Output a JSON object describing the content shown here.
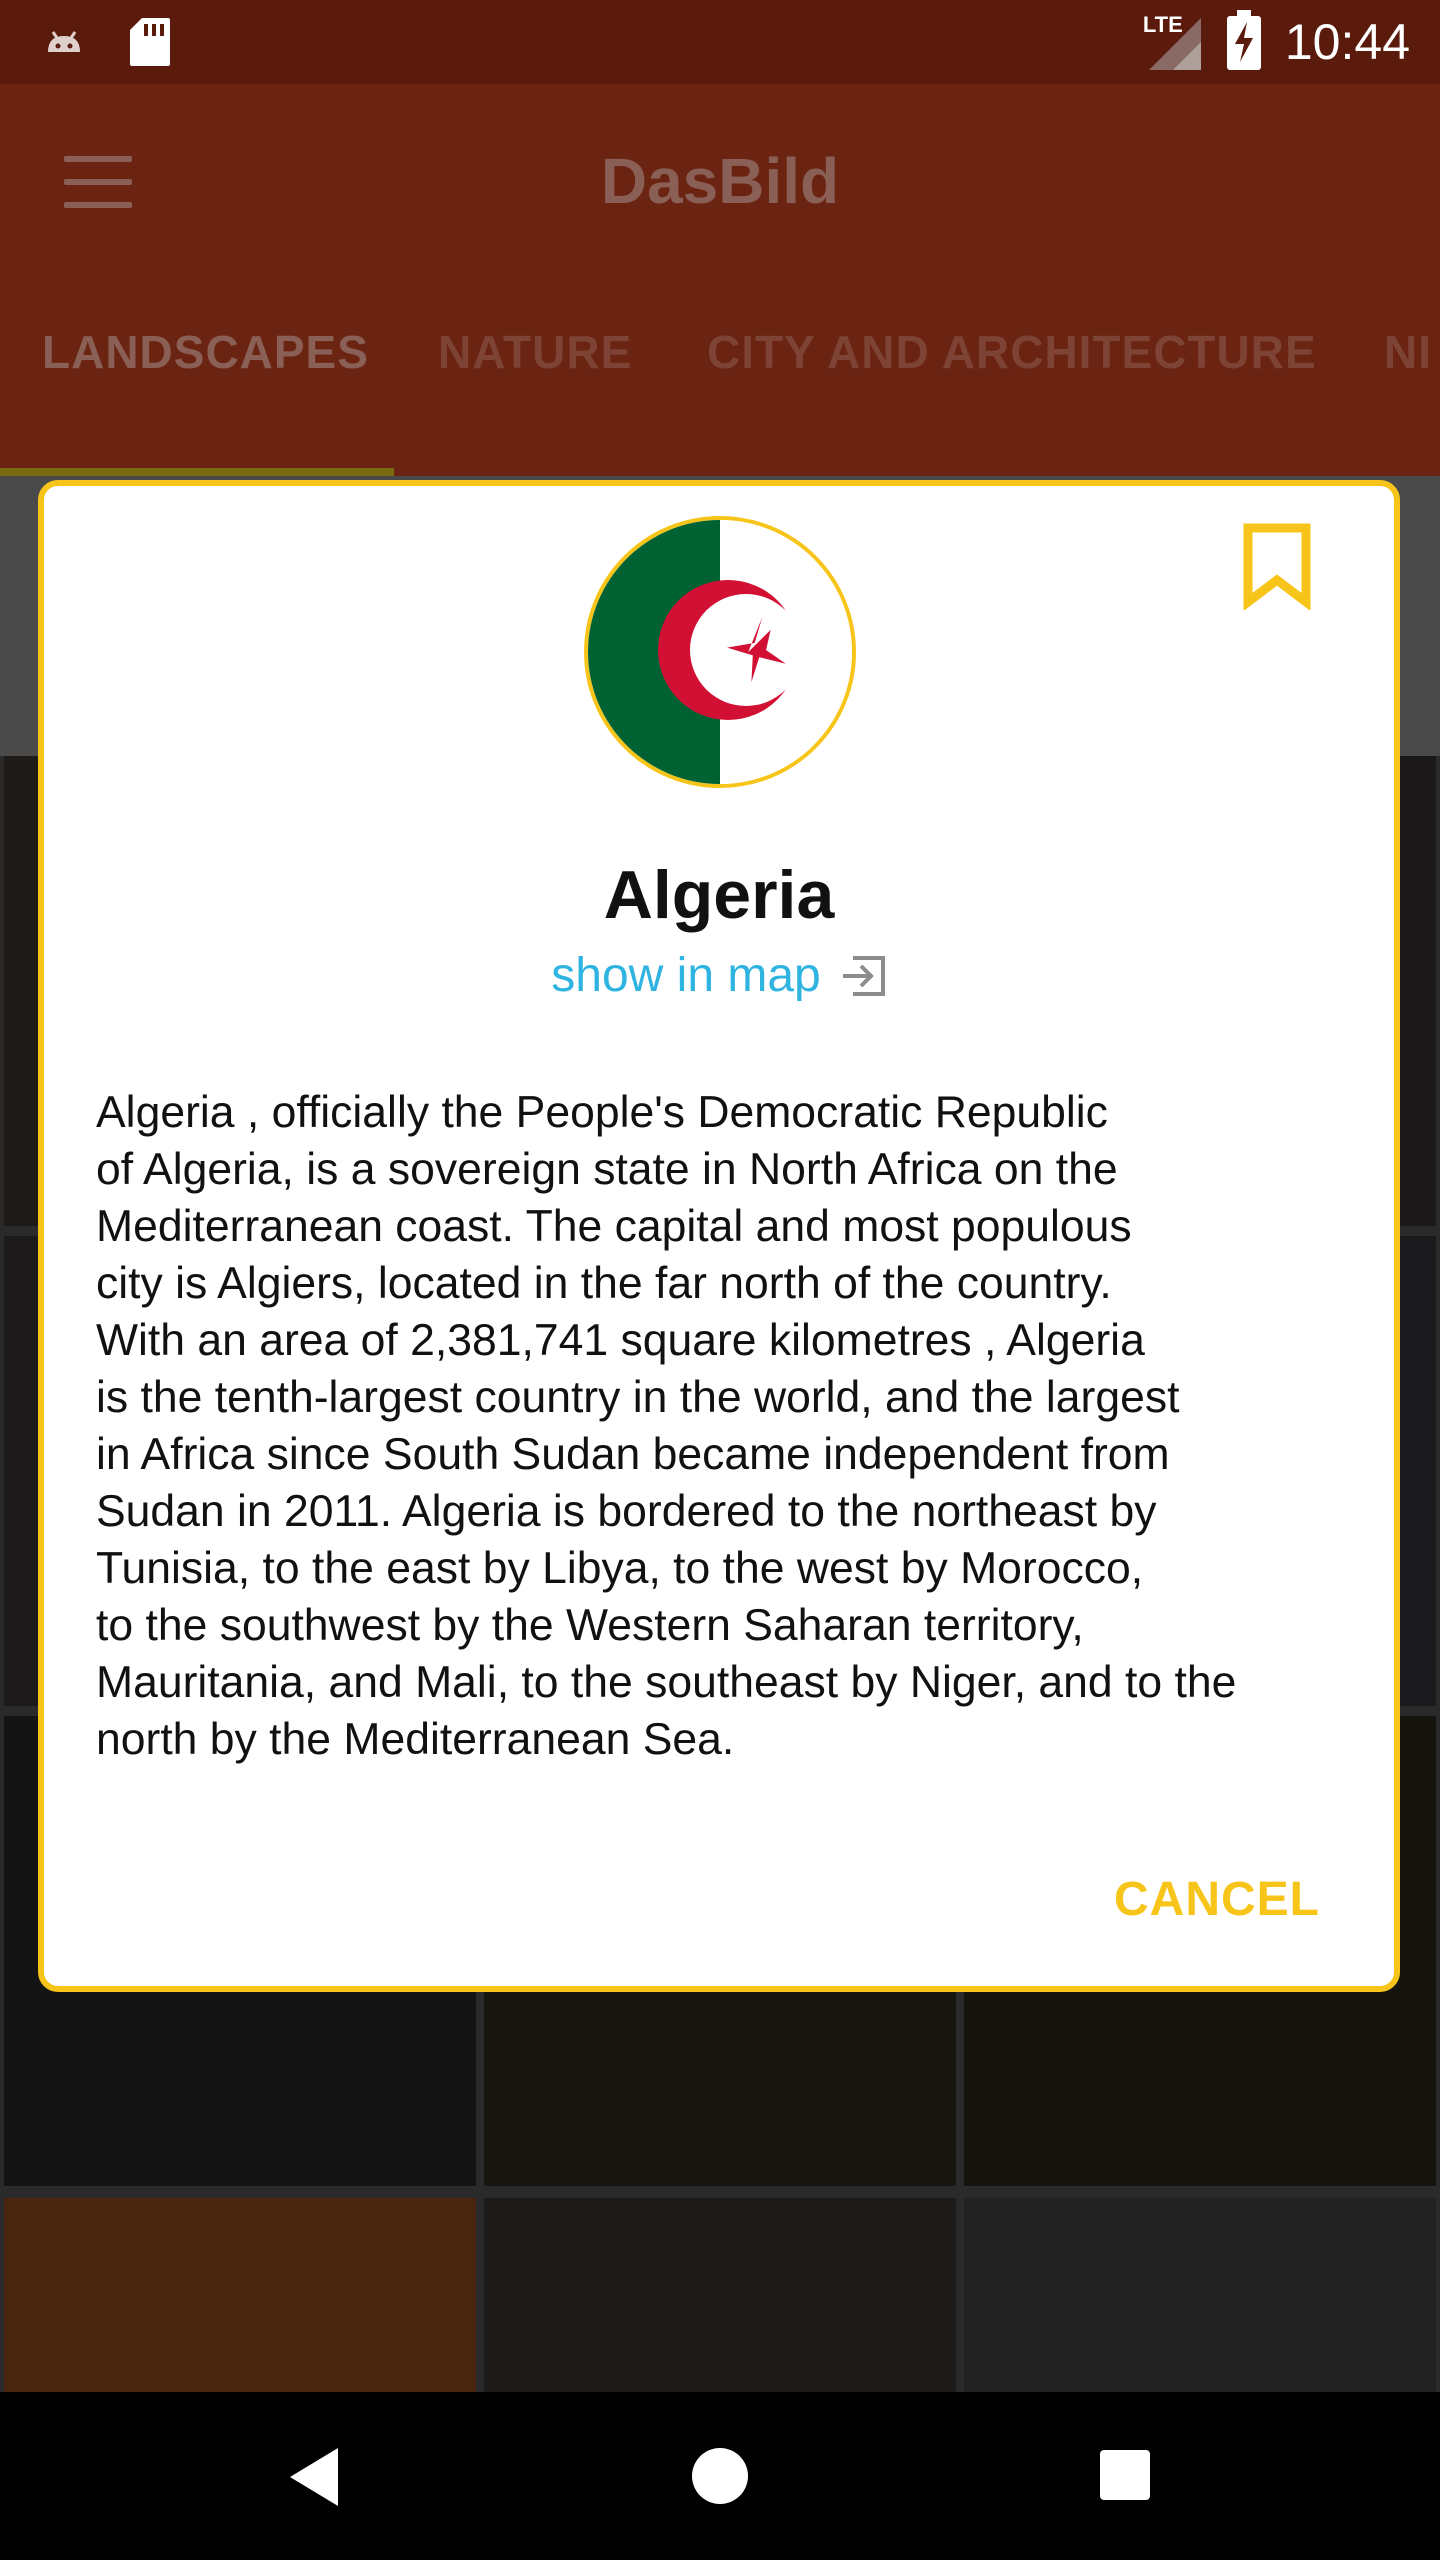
{
  "status_bar": {
    "time": "10:44",
    "network": "LTE"
  },
  "app_bar": {
    "title": "DasBild"
  },
  "tabs": [
    "LANDSCAPES",
    "NATURE",
    "CITY AND ARCHITECTURE",
    "NI"
  ],
  "dialog": {
    "country": "Algeria",
    "map_link": "show in map",
    "description": "Algeria , officially the People's Democratic Republic\nof Algeria, is a sovereign state in North Africa on the\nMediterranean coast. The capital and most populous\ncity is Algiers, located in the far north of the country.\nWith an area of 2,381,741 square kilometres , Algeria\nis the tenth-largest country in the world, and the largest\nin Africa since South Sudan became independent from\nSudan in 2011. Algeria is bordered to the northeast by\nTunisia, to the east by Libya, to the west by Morocco,\nto the southwest by the Western Saharan territory,\nMauritania, and Mali, to the southeast by Niger, and to the\nnorth by the Mediterranean Sea.",
    "cancel_label": "CANCEL"
  },
  "colors": {
    "accent": "#f7c51a",
    "link": "#2fb3e0",
    "app_bar": "#6b2412",
    "flag_green": "#006233",
    "flag_red": "#d21034"
  },
  "icons": [
    "android-icon",
    "sd-card-icon",
    "signal-icon",
    "battery-charging-icon",
    "menu-icon",
    "bookmark-icon",
    "open-external-icon",
    "back-icon",
    "home-icon",
    "recents-icon"
  ]
}
